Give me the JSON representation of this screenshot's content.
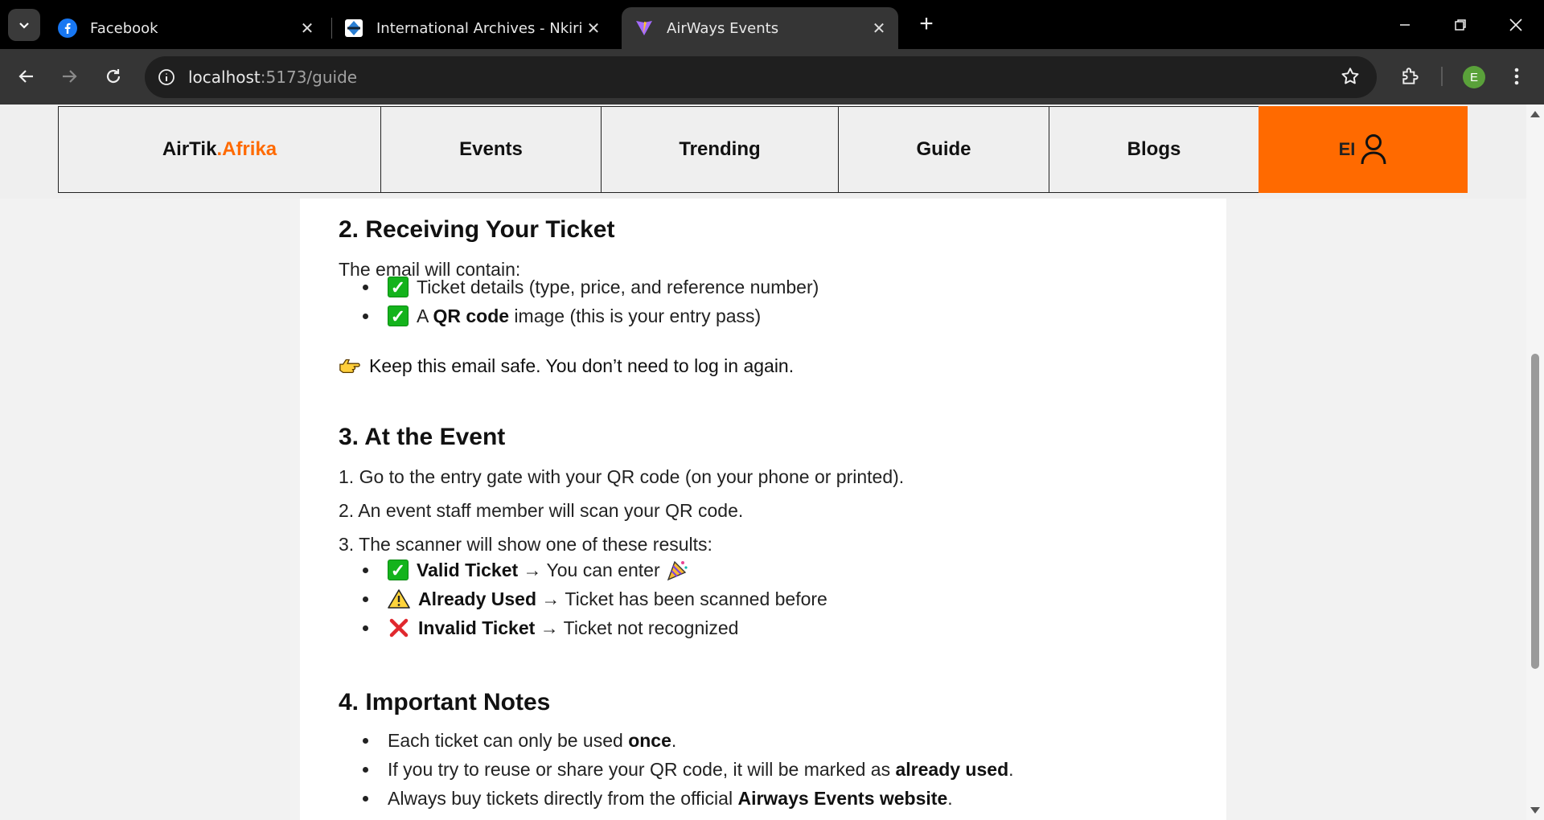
{
  "browser": {
    "tabs": [
      {
        "title": "Facebook",
        "icon": "facebook-icon"
      },
      {
        "title": "International Archives - Nkiri",
        "icon": "nkiri-icon"
      },
      {
        "title": "AirWays Events",
        "icon": "vite-icon"
      }
    ],
    "url_host": "localhost",
    "url_rest": ":5173/guide",
    "profile_initial": "E"
  },
  "site": {
    "brand_main": "AirTik",
    "brand_accent": ".Afrika",
    "nav": [
      "Events",
      "Trending",
      "Guide",
      "Blogs"
    ],
    "user_initials": "EI",
    "accent_color": "#ff6a00"
  },
  "guide": {
    "section2": {
      "heading": "2. Receiving Your Ticket",
      "intro": "The email will contain:",
      "item1": "Ticket details (type, price, and reference number)",
      "item2_pre": "A ",
      "item2_bold": "QR code",
      "item2_post": " image (this is your entry pass)",
      "note": "Keep this email safe. You don’t need to log in again."
    },
    "section3": {
      "heading": "3. At the Event",
      "step1": "1. Go to the entry gate with your QR code (on your phone or printed).",
      "step2": "2. An event staff member will scan your QR code.",
      "step3": "3. The scanner will show one of these results:",
      "results": [
        {
          "label": "Valid Ticket",
          "text": " → You can enter "
        },
        {
          "label": "Already Used",
          "text": " → Ticket has been scanned before"
        },
        {
          "label": "Invalid Ticket",
          "text": " → Ticket not recognized"
        }
      ]
    },
    "section4": {
      "heading": "4. Important Notes",
      "n1_pre": "Each ticket can only be used ",
      "n1_bold": "once",
      "n1_post": ".",
      "n2_pre": "If you try to reuse or share your QR code, it will be marked as ",
      "n2_bold": "already used",
      "n2_post": ".",
      "n3_pre": "Always buy tickets directly from the official ",
      "n3_bold": "Airways Events website",
      "n3_post": "."
    }
  }
}
